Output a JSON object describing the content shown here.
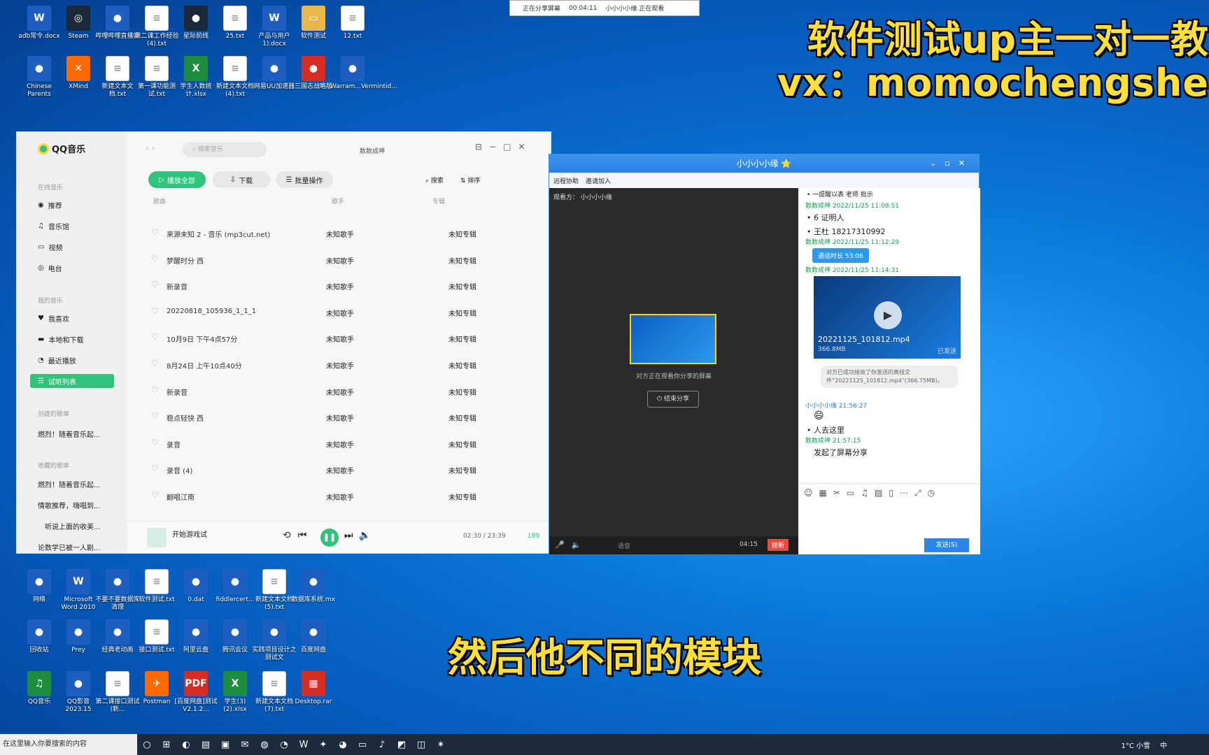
{
  "overlay": {
    "title_line1": "软件测试up主一对一教",
    "title_line2": "vx：momochengshe",
    "subtitle": "然后他不同的模块"
  },
  "share_bar": {
    "status": "正在分享屏幕",
    "time": "00:04:11",
    "text": "小小小小缘 正在观看"
  },
  "desktop_icons": [
    {
      "label": "adb常令.docx",
      "icon": "word-icon"
    },
    {
      "label": "Steam",
      "icon": "steam-icon"
    },
    {
      "label": "哔哩哔哩直播姬",
      "icon": "bili-icon"
    },
    {
      "label": "第二课工作经验(4).txt",
      "icon": "txt-icon"
    },
    {
      "label": "星际前线",
      "icon": "eve-icon"
    },
    {
      "label": "25.txt",
      "icon": "txt-icon"
    },
    {
      "label": "产品与用户1).docx",
      "icon": "word-icon"
    },
    {
      "label": "软件测试",
      "icon": "folder-icon"
    },
    {
      "label": "12.txt",
      "icon": "txt-icon"
    },
    {
      "label": "Chinese Parents",
      "icon": "game-icon"
    },
    {
      "label": "XMind",
      "icon": "xmind-icon"
    },
    {
      "label": "新建文本文档.txt",
      "icon": "txt-icon"
    },
    {
      "label": "第一课功能测试.txt",
      "icon": "txt-icon"
    },
    {
      "label": "学生人数统计.xlsx",
      "icon": "excel-icon"
    },
    {
      "label": "新建文本文档 (4).txt",
      "icon": "txt-icon"
    },
    {
      "label": "网易UU加速器",
      "icon": "uu-icon"
    },
    {
      "label": "三国志战略版",
      "icon": "sg-icon"
    },
    {
      "label": "Warram...Vermintid...",
      "icon": "war-icon"
    },
    {
      "label": "网络",
      "icon": "network-icon"
    },
    {
      "label": "Microsoft Word 2010",
      "icon": "word-icon"
    },
    {
      "label": "不要不要数据库清理",
      "icon": "app-icon"
    },
    {
      "label": "软件测试.txt",
      "icon": "txt-icon"
    },
    {
      "label": "0.dat",
      "icon": "file-icon"
    },
    {
      "label": "fiddlercert...",
      "icon": "cert-icon"
    },
    {
      "label": "新建文本文档 (5).txt",
      "icon": "txt-icon"
    },
    {
      "label": "数据库系统.mx",
      "icon": "file-icon"
    },
    {
      "label": "回收站",
      "icon": "recycle-icon"
    },
    {
      "label": "Prey",
      "icon": "file-icon"
    },
    {
      "label": "经典老动画",
      "icon": "img-icon"
    },
    {
      "label": "接口测试.txt",
      "icon": "txt-icon"
    },
    {
      "label": "阿里云盘",
      "icon": "cloud-icon"
    },
    {
      "label": "腾讯会议",
      "icon": "meeting-icon"
    },
    {
      "label": "实践项目设计之测试文",
      "icon": "doc-icon"
    },
    {
      "label": "百度网盘",
      "icon": "baidu-icon"
    },
    {
      "label": "QQ音乐",
      "icon": "qqmusic-icon"
    },
    {
      "label": "QQ影音2023.15",
      "icon": "qqvideo-icon"
    },
    {
      "label": "第二课接口测试(新...",
      "icon": "txt-icon"
    },
    {
      "label": "Postman",
      "icon": "postman-icon"
    },
    {
      "label": "[百度网盘]测试V2.1.2...",
      "icon": "pdf-icon"
    },
    {
      "label": "学生(3)(2).xlsx",
      "icon": "excel-icon"
    },
    {
      "label": "新建文本文档 (7).txt",
      "icon": "txt-icon"
    },
    {
      "label": "Desktop.rar",
      "icon": "rar-icon"
    }
  ],
  "qqmusic": {
    "logo": "QQ音乐",
    "search_placeholder": "搜索音乐",
    "user": "数数成神",
    "online_music": "在线音乐",
    "nav": [
      "推荐",
      "音乐馆",
      "视频",
      "电台"
    ],
    "my_music": "我的音乐",
    "my_items": [
      "我喜欢",
      "本地和下载",
      "最近播放",
      "试听列表"
    ],
    "created": "创建的歌单",
    "created_items": [
      "燃烈！随着音乐起..."
    ],
    "collected": "收藏的歌单",
    "collected_items": [
      "燃烈！随着音乐起...",
      "情歌推荐，嗨唱到...",
      "听说上面的收美...",
      "论数学已被一人剧..."
    ],
    "actions": {
      "play_all": "播放全部",
      "download": "下载",
      "batch": "批量操作",
      "search": "搜索",
      "sort": "排序"
    },
    "columns": {
      "title": "歌曲",
      "artist": "歌手",
      "album": "专辑"
    },
    "songs": [
      {
        "title": "来源未知 2 - 音乐 (mp3cut.net)",
        "artist": "未知歌手",
        "album": "未知专辑"
      },
      {
        "title": "梦醒时分 西",
        "artist": "未知歌手",
        "album": "未知专辑"
      },
      {
        "title": "新录音",
        "artist": "未知歌手",
        "album": "未知专辑"
      },
      {
        "title": "20220818_105936_1_1_1",
        "artist": "未知歌手",
        "album": "未知专辑"
      },
      {
        "title": "10月9日 下午4点57分",
        "artist": "未知歌手",
        "album": "未知专辑"
      },
      {
        "title": "8月24日 上午10点40分",
        "artist": "未知歌手",
        "album": "未知专辑"
      },
      {
        "title": "新录音",
        "artist": "未知歌手",
        "album": "未知专辑"
      },
      {
        "title": "稳点轻快 西",
        "artist": "未知歌手",
        "album": "未知专辑"
      },
      {
        "title": "录音",
        "artist": "未知歌手",
        "album": "未知专辑"
      },
      {
        "title": "录音 (4)",
        "artist": "未知歌手",
        "album": "未知专辑"
      },
      {
        "title": "翻唱江南",
        "artist": "未知歌手",
        "album": "未知专辑"
      }
    ],
    "now_playing": "开始游戏试",
    "time": "02:30 / 23:39",
    "count": "189"
  },
  "chat": {
    "title": "小小小小缘 ⭐",
    "tool1": "远程协助",
    "tool2": "邀请加入",
    "viewer_label": "观看方：",
    "viewer": "小小小小缘",
    "screen_caption": "对方正在观看你分享的屏幕",
    "stop_share": "结束分享",
    "call_time": "04:15",
    "hangup": "挂断",
    "mute_label": "语音",
    "messages": [
      {
        "ts": "",
        "text": "• 一提醒以表 老师 批示"
      },
      {
        "ts": "数数成神 2022/11/25 11:08:51",
        "text": ""
      },
      {
        "ts": "",
        "text": "• 6 证明人"
      },
      {
        "ts": "",
        "text": "• 王杜 18217310992"
      },
      {
        "ts": "数数成神 2022/11/25 11:12:29",
        "text": ""
      },
      {
        "ts": "",
        "text": "通话时长 53:06"
      },
      {
        "ts": "数数成神 2022/11/25 11:14:31",
        "text": ""
      }
    ],
    "video_file": "20221125_101812.mp4",
    "video_size": "366.8MB",
    "video_status": "已发送",
    "received_note": "对方已成功接收了你发送的离线文件“20221125_101812.mp4”(366.75MB)。",
    "sender2": "小小小小缘 21:56:27",
    "msg2": "• 人去这里",
    "sender3": "数数成神 21:57:15",
    "msg3": "发起了屏幕分享",
    "send": "发送(S)"
  },
  "taskbar": {
    "search": "在这里输入你要搜索的内容",
    "weather": "1°C 小雪",
    "ime": "中"
  }
}
